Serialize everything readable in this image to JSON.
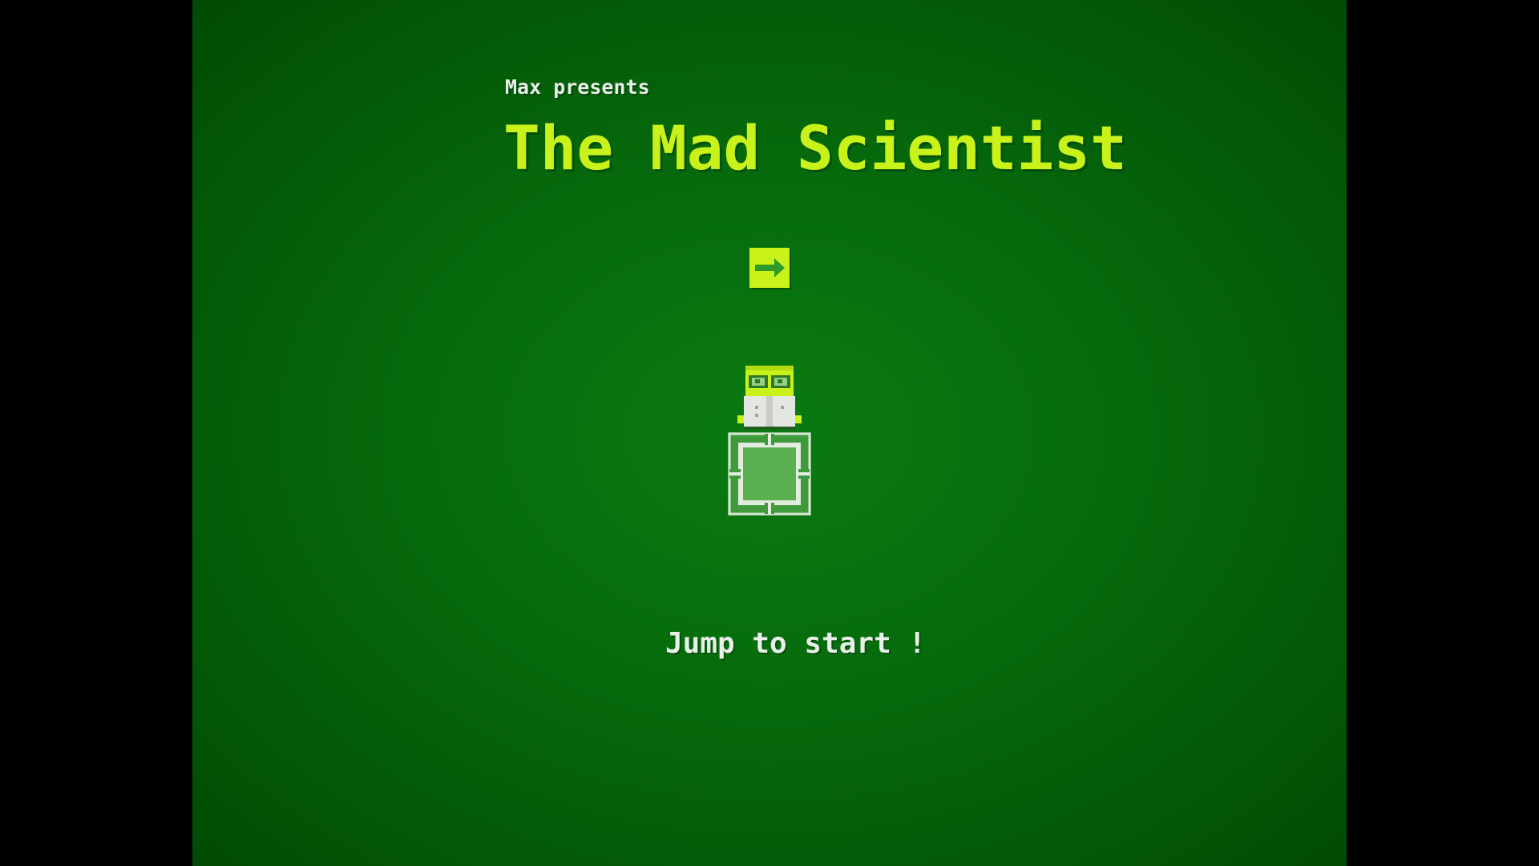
{
  "game": {
    "presenter": "Max presents",
    "title": "The Mad Scientist",
    "start_prompt": "Jump to start !"
  },
  "icons": {
    "sign": "arrow-right-icon",
    "player": "mad-scientist-sprite",
    "block": "platform-block"
  },
  "colors": {
    "background": "#066a0c",
    "accent": "#c9f21a",
    "text": "#e9efe9",
    "letterbox": "#000000"
  }
}
